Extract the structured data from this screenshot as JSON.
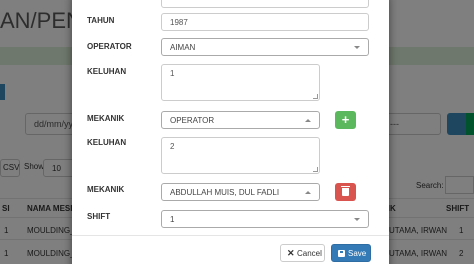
{
  "background": {
    "page_title": "AN/PENGA",
    "date_placeholder": "dd/mm/yy",
    "right_select": "---",
    "csv_button": "CSV",
    "show_label": "Show",
    "entries_value": "10",
    "search_label": "Search:",
    "table": {
      "headers": [
        "SI",
        "NAMA MESIN",
        "NIK",
        "SHIFT"
      ],
      "rows": [
        {
          "si": "1",
          "mesin": "MOULDING_",
          "nik": "UTAMA, IRWAN",
          "shift": "1"
        },
        {
          "si": "1",
          "mesin": "MOULDING_",
          "nik": "UTAMA, IRWAN",
          "shift": "2"
        }
      ]
    }
  },
  "modal": {
    "tahun_label": "TAHUN",
    "tahun_value": "1987",
    "operator_label": "OPERATOR",
    "operator_value": "AIMAN",
    "keluhan1_label": "KELUHAN",
    "keluhan1_value": "1",
    "mekanik1_label": "MEKANIK",
    "mekanik1_value": "OPERATOR",
    "add_button": "+",
    "keluhan2_label": "KELUHAN",
    "keluhan2_value": "2",
    "mekanik2_label": "MEKANIK",
    "mekanik2_value": "ABDULLAH MUIS, DUL FADLI",
    "shift_label": "SHIFT",
    "shift_value": "1",
    "cancel_label": "Cancel",
    "save_label": "Save"
  },
  "colors": {
    "primary": "#337ab7",
    "success": "#5cb85c",
    "danger": "#d9534f",
    "alert_bg": "#dff0d8"
  },
  "icons": [
    "chevron-down-icon",
    "chevron-up-icon",
    "plus-icon",
    "trash-icon",
    "close-icon",
    "save-icon",
    "search-icon"
  ]
}
